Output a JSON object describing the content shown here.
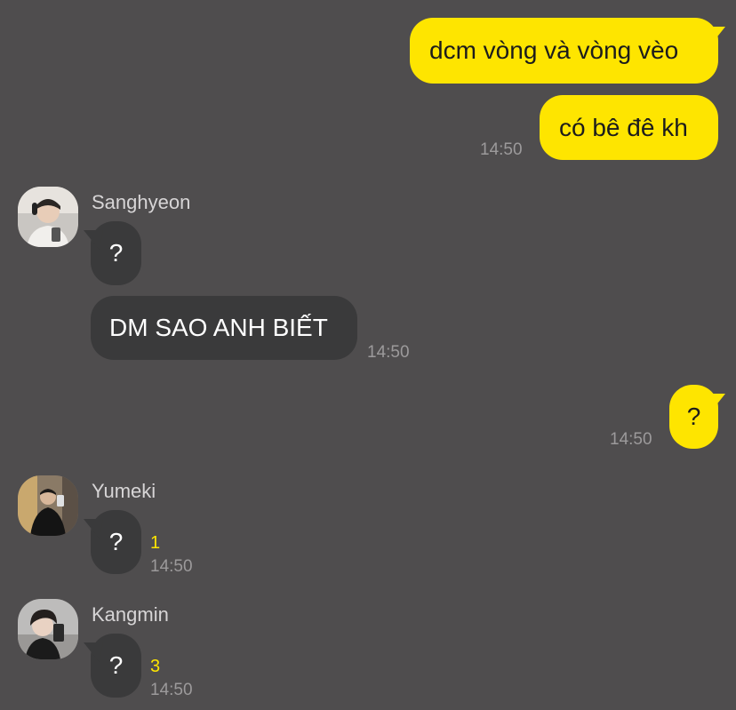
{
  "messages": {
    "out1": {
      "text": "dcm vòng và vòng vèo"
    },
    "out2": {
      "text": "có bê đê kh",
      "time": "14:50"
    },
    "sanghyeon": {
      "name": "Sanghyeon",
      "msg1": "?",
      "msg2": "DM SAO ANH BIẾT",
      "time": "14:50"
    },
    "out3": {
      "text": "?",
      "time": "14:50"
    },
    "yumeki": {
      "name": "Yumeki",
      "msg": "?",
      "unread": "1",
      "time": "14:50"
    },
    "kangmin": {
      "name": "Kangmin",
      "msg": "?",
      "unread": "3",
      "time": "14:50"
    }
  },
  "colors": {
    "background": "#4f4d4e",
    "outgoing_bubble": "#fee500",
    "incoming_bubble": "#3a3a3b",
    "unread_count": "#fee500",
    "timestamp": "#9c9a9b"
  },
  "icons": {
    "sanghyeon_avatar": "profile-photo-icon",
    "yumeki_avatar": "profile-photo-icon",
    "kangmin_avatar": "profile-photo-icon"
  }
}
